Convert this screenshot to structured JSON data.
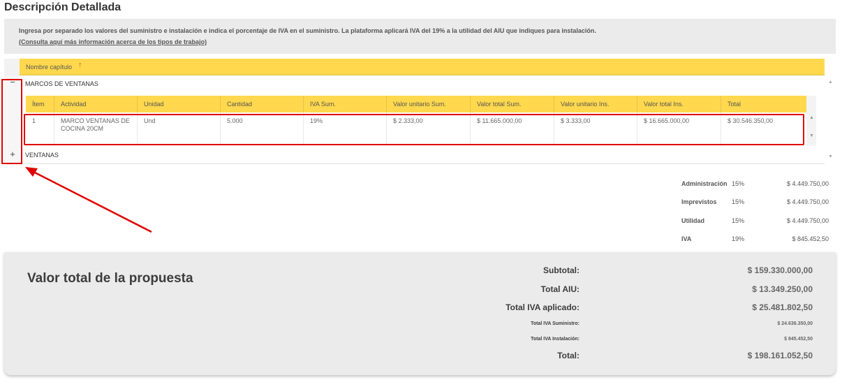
{
  "page": {
    "title": "Descripción Detallada",
    "info_text": "Ingresa por separado los valores del suministro e instalación e indica el porcentaje de IVA en el suministro. La plataforma aplicará IVA del 19% a la utilidad del AIU que indiques para instalación.",
    "info_link": "(Consulta aquí más información acerca de los tipos de trabajo)"
  },
  "grid": {
    "header_label": "Nombre capítulo",
    "sort_icon": "arrow-up-icon",
    "chapters": [
      {
        "name": "MARCOS DE VENTANAS",
        "expander": "−",
        "expanded": true
      },
      {
        "name": "VENTANAS",
        "expander": "+",
        "expanded": false
      }
    ],
    "columns": [
      "Ítem",
      "Actividad",
      "Unidad",
      "Cantidad",
      "IVA Sum.",
      "Valor unitario Sum.",
      "Valor total Sum.",
      "Valor unitario Ins.",
      "Valor total Ins.",
      "Total"
    ],
    "rows": [
      {
        "item": "1",
        "actividad": "MARCO VENTANAS DE COCINA 20CM",
        "unidad": "Und",
        "cantidad": "5.000",
        "iva_sum": "19%",
        "valor_unitario_sum": "$ 2.333,00",
        "valor_total_sum": "$ 11.665.000,00",
        "valor_unitario_ins": "$ 3.333,00",
        "valor_total_ins": "$ 16.665.000,00",
        "total": "$ 30.546.350,00"
      }
    ]
  },
  "aiu": [
    {
      "label": "Administración",
      "pct": "15%",
      "value": "$ 4.449.750,00"
    },
    {
      "label": "Imprevistos",
      "pct": "15%",
      "value": "$ 4.449.750,00"
    },
    {
      "label": "Utilidad",
      "pct": "15%",
      "value": "$ 4.449.750,00"
    },
    {
      "label": "IVA",
      "pct": "19%",
      "value": "$ 845.452,50"
    }
  ],
  "summary": {
    "title": "Valor total de la propuesta",
    "lines": [
      {
        "label": "Subtotal:",
        "value": "$ 159.330.000,00"
      },
      {
        "label": "Total AIU:",
        "value": "$ 13.349.250,00"
      },
      {
        "label": "Total IVA aplicado:",
        "value": "$ 25.481.802,50"
      },
      {
        "label": "Total IVA Suministro:",
        "value": "$ 24.636.350,00"
      },
      {
        "label": "Total IVA Instalación:",
        "value": "$ 845.452,50"
      },
      {
        "label": "Total:",
        "value": "$ 198.161.052,50"
      }
    ]
  },
  "colors": {
    "header_yellow": "#ffd84d",
    "highlight_red": "#e00000",
    "panel_gray": "#ebebeb"
  }
}
